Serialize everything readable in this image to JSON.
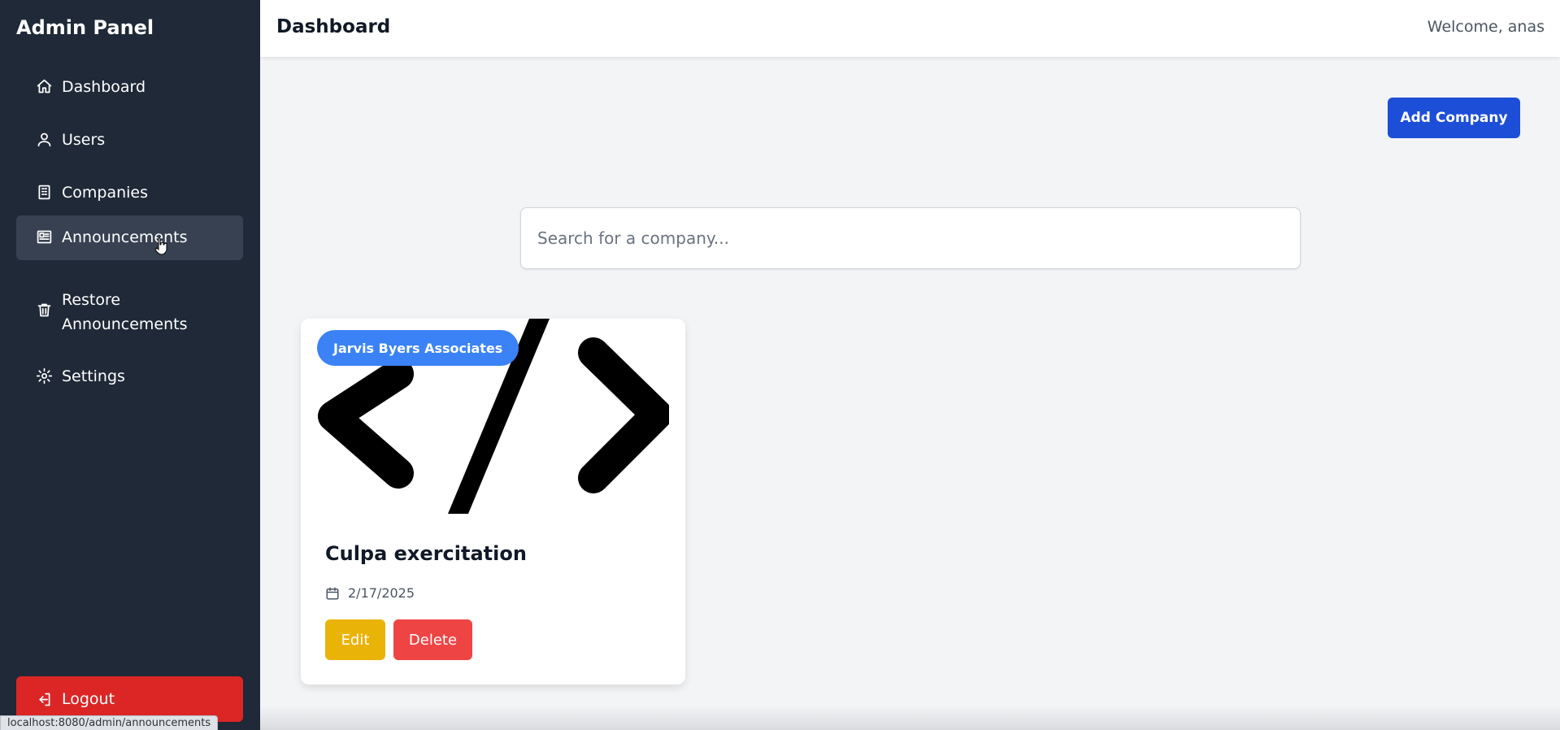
{
  "sidebar": {
    "brand": "Admin Panel",
    "items": [
      {
        "label": "Dashboard",
        "icon": "home-icon"
      },
      {
        "label": "Users",
        "icon": "user-icon"
      },
      {
        "label": "Companies",
        "icon": "building-icon"
      },
      {
        "label": "Announcements",
        "icon": "newspaper-icon",
        "active": true
      },
      {
        "label": "Restore Announcements",
        "icon": "trash-icon"
      },
      {
        "label": "Settings",
        "icon": "gear-icon"
      }
    ],
    "logout_label": "Logout"
  },
  "header": {
    "title": "Dashboard",
    "welcome": "Welcome, anas"
  },
  "main": {
    "add_company_label": "Add Company",
    "search_placeholder": "Search for a company...",
    "cards": [
      {
        "company": "Jarvis Byers Associates",
        "title": "Culpa exercitation",
        "date": "2/17/2025",
        "edit_label": "Edit",
        "delete_label": "Delete"
      }
    ]
  },
  "statusbar": {
    "url": "localhost:8080/admin/announcements"
  },
  "colors": {
    "sidebar_bg": "#1f2937",
    "active_item_bg": "#374151",
    "logout_bg": "#dc2626",
    "add_button_bg": "#1d4ed8",
    "badge_bg": "#3b82f6",
    "edit_bg": "#eab308",
    "delete_bg": "#ef4444",
    "page_bg": "#f3f4f6"
  }
}
